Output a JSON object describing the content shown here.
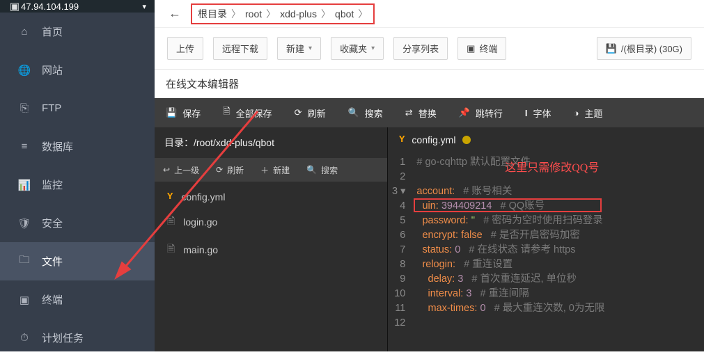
{
  "server": {
    "ip": "47.94.104.199"
  },
  "sidebar": {
    "items": [
      {
        "icon": "home",
        "label": "首页"
      },
      {
        "icon": "globe",
        "label": "网站"
      },
      {
        "icon": "ftp",
        "label": "FTP"
      },
      {
        "icon": "db",
        "label": "数据库"
      },
      {
        "icon": "monitor",
        "label": "监控"
      },
      {
        "icon": "shield",
        "label": "安全"
      },
      {
        "icon": "folder",
        "label": "文件"
      },
      {
        "icon": "terminal",
        "label": "终端"
      },
      {
        "icon": "task",
        "label": "计划任务"
      }
    ],
    "active_index": 6
  },
  "breadcrumb": {
    "segments": [
      "根目录",
      "root",
      "xdd-plus",
      "qbot"
    ]
  },
  "toolbar": {
    "upload": "上传",
    "remote": "远程下载",
    "new": "新建",
    "fav": "收藏夹",
    "share": "分享列表",
    "term": "终端",
    "disk": "/(根目录) (30G)"
  },
  "editor_title": "在线文本编辑器",
  "editbar": {
    "save": "保存",
    "save_all": "全部保存",
    "refresh": "刷新",
    "search": "搜索",
    "replace": "替换",
    "goto": "跳转行",
    "font": "字体",
    "theme": "主题"
  },
  "filetree": {
    "cwd_label": "目录：",
    "cwd": "/root/xdd-plus/qbot",
    "tb": {
      "up": "上一级",
      "refresh": "刷新",
      "new": "新建",
      "search": "搜索"
    },
    "files": [
      "config.yml",
      "login.go",
      "main.go"
    ]
  },
  "tab": {
    "name": "config.yml"
  },
  "annotation": "这里只需修改QQ号",
  "code": {
    "lines": [
      {
        "n": 1,
        "t": "comment",
        "text": "# go-cqhttp 默认配置文件"
      },
      {
        "n": 2,
        "t": "blank",
        "text": ""
      },
      {
        "n": 3,
        "t": "kv",
        "key": "account:",
        "comment": "# 账号相关",
        "fold": true
      },
      {
        "n": 4,
        "t": "kv",
        "indent": 1,
        "key": "uin:",
        "val": "394409214",
        "vtype": "num",
        "comment": "# QQ账号",
        "hl": true
      },
      {
        "n": 5,
        "t": "kv",
        "indent": 1,
        "key": "password:",
        "val": "''",
        "vtype": "str",
        "comment": "# 密码为空时使用扫码登录"
      },
      {
        "n": 6,
        "t": "kv",
        "indent": 1,
        "key": "encrypt:",
        "val": "false",
        "vtype": "bool",
        "comment": "# 是否开启密码加密"
      },
      {
        "n": 7,
        "t": "kv",
        "indent": 1,
        "key": "status:",
        "val": "0",
        "vtype": "num",
        "comment": "# 在线状态 请参考 https"
      },
      {
        "n": 8,
        "t": "kv",
        "indent": 1,
        "key": "relogin:",
        "comment": "# 重连设置"
      },
      {
        "n": 9,
        "t": "kv",
        "indent": 2,
        "key": "delay:",
        "val": "3",
        "vtype": "num",
        "comment": "# 首次重连延迟, 单位秒"
      },
      {
        "n": 10,
        "t": "kv",
        "indent": 2,
        "key": "interval:",
        "val": "3",
        "vtype": "num",
        "comment": "# 重连间隔"
      },
      {
        "n": 11,
        "t": "kv",
        "indent": 2,
        "key": "max-times:",
        "val": "0",
        "vtype": "num",
        "comment": "# 最大重连次数, 0为无限"
      },
      {
        "n": 12,
        "t": "blank",
        "text": ""
      }
    ]
  }
}
